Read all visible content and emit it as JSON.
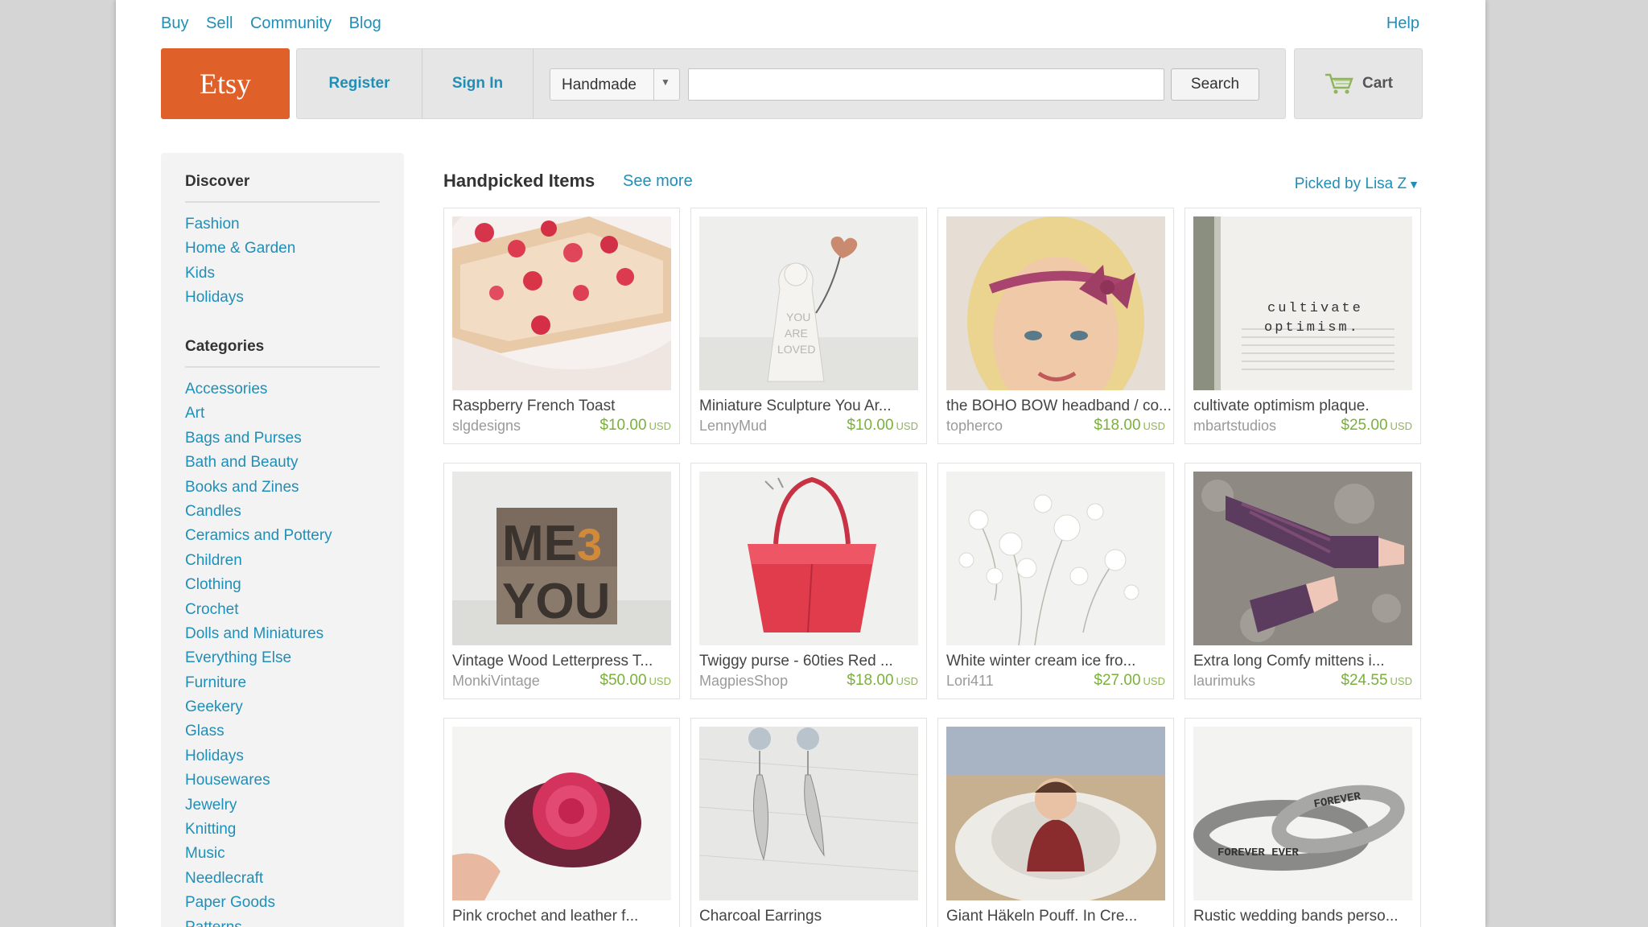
{
  "topnav": {
    "buy": "Buy",
    "sell": "Sell",
    "community": "Community",
    "blog": "Blog",
    "help": "Help"
  },
  "header": {
    "logo": "Etsy",
    "register": "Register",
    "sign_in": "Sign In",
    "category_select": "Handmade",
    "search_value": "",
    "search_button": "Search",
    "cart": "Cart"
  },
  "sidebar": {
    "discover_heading": "Discover",
    "discover": [
      "Fashion",
      "Home & Garden",
      "Kids",
      "Holidays"
    ],
    "categories_heading": "Categories",
    "categories": [
      "Accessories",
      "Art",
      "Bags and Purses",
      "Bath and Beauty",
      "Books and Zines",
      "Candles",
      "Ceramics and Pottery",
      "Children",
      "Clothing",
      "Crochet",
      "Dolls and Miniatures",
      "Everything Else",
      "Furniture",
      "Geekery",
      "Glass",
      "Holidays",
      "Housewares",
      "Jewelry",
      "Knitting",
      "Music",
      "Needlecraft",
      "Paper Goods",
      "Patterns"
    ]
  },
  "main": {
    "section_title": "Handpicked Items",
    "see_more": "See more",
    "picked_by": "Picked by Lisa Z",
    "items": [
      {
        "title": "Raspberry French Toast",
        "shop": "slgdesigns",
        "price": "$10.00",
        "currency": "USD"
      },
      {
        "title": "Miniature Sculpture You Ar...",
        "shop": "LennyMud",
        "price": "$10.00",
        "currency": "USD"
      },
      {
        "title": "the BOHO BOW headband / co...",
        "shop": "topherco",
        "price": "$18.00",
        "currency": "USD"
      },
      {
        "title": "cultivate optimism plaque.",
        "shop": "mbartstudios",
        "price": "$25.00",
        "currency": "USD"
      },
      {
        "title": "Vintage Wood Letterpress T...",
        "shop": "MonkiVintage",
        "price": "$50.00",
        "currency": "USD"
      },
      {
        "title": "Twiggy purse - 60ties Red ...",
        "shop": "MagpiesShop",
        "price": "$18.00",
        "currency": "USD"
      },
      {
        "title": "White winter cream ice fro...",
        "shop": "Lori411",
        "price": "$27.00",
        "currency": "USD"
      },
      {
        "title": "Extra long Comfy mittens i...",
        "shop": "laurimuks",
        "price": "$24.55",
        "currency": "USD"
      },
      {
        "title": "Pink crochet and leather f...",
        "shop": "",
        "price": "",
        "currency": ""
      },
      {
        "title": "Charcoal Earrings",
        "shop": "",
        "price": "",
        "currency": ""
      },
      {
        "title": "Giant Häkeln Pouff. In Cre...",
        "shop": "",
        "price": "",
        "currency": ""
      },
      {
        "title": "Rustic wedding bands perso...",
        "shop": "",
        "price": "",
        "currency": ""
      }
    ],
    "plaque_text_1": "cultivate",
    "plaque_text_2": "optimism.",
    "sculpture_text_1": "YOU",
    "sculpture_text_2": "ARE",
    "sculpture_text_3": "LOVED",
    "letterpress_text_1": "ME",
    "letterpress_text_2": "YOU",
    "ring_text_1": "FOREVER",
    "ring_text_2": "FOREVER EVER"
  },
  "colors": {
    "brand": "#e0602a",
    "link": "#1f8fb8",
    "price": "#7ab03c"
  }
}
